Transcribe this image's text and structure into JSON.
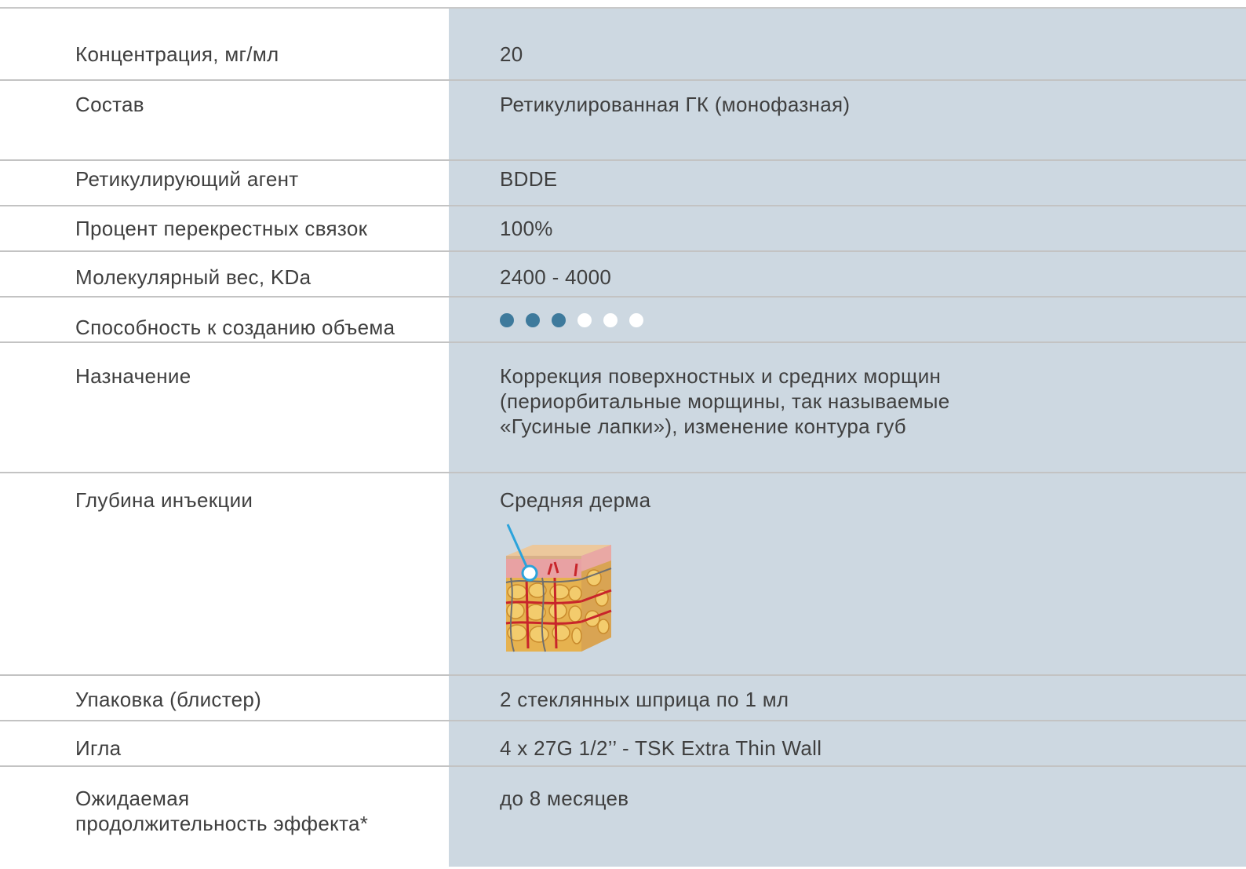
{
  "rows": [
    {
      "label": "Концентрация, мг/мл",
      "value": "20"
    },
    {
      "label": "Состав",
      "value": "Ретикулированная ГК (монофазная)"
    },
    {
      "label": "Ретикулирующий агент",
      "value": "BDDE"
    },
    {
      "label": "Процент перекрестных связок",
      "value": "100%"
    },
    {
      "label": "Молекулярный вес, KDa",
      "value": "2400 - 4000"
    },
    {
      "label": "Способность к созданию объема",
      "rating": {
        "filled": 3,
        "total": 6
      }
    },
    {
      "label": "Назначение",
      "value": "Коррекция поверхностных и средних морщин\n(периорбитальные морщины, так называемые\n«Гусиные лапки»), изменение контура губ"
    },
    {
      "label": "Глубина инъекции",
      "value": "Средняя дерма",
      "icon": "skin-layers-illustration"
    },
    {
      "label": "Упаковка (блистер)",
      "value": "2 стеклянных шприца по 1 мл"
    },
    {
      "label": "Игла",
      "value": "4 x 27G 1/2’’ - TSK Extra Thin Wall"
    },
    {
      "label": "Ожидаемая\nпродолжительность эффекта*",
      "value": "до 8 месяцев"
    }
  ],
  "colors": {
    "value_column_bg": "#cdd8e1",
    "dot_filled": "#3e7a9c",
    "dot_empty": "#ffffff",
    "divider": "#c3c3c3"
  }
}
